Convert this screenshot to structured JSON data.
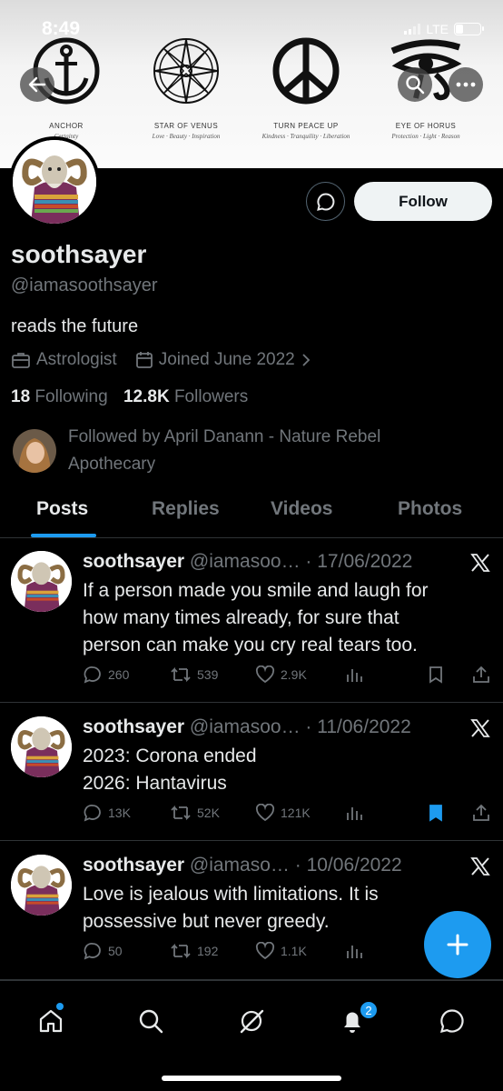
{
  "status_bar": {
    "time": "8:49",
    "network": "LTE",
    "battery_level": 0.3
  },
  "banner": {
    "symbols": [
      {
        "name": "ANCHOR",
        "subtitle": "Certainty",
        "icon": "anchor-icon"
      },
      {
        "name": "STAR OF VENUS",
        "subtitle": "Love · Beauty · Inspiration",
        "icon": "star-of-venus-icon"
      },
      {
        "name": "TURN PEACE UP",
        "subtitle": "Kindness · Tranquility · Liberation",
        "icon": "peace-icon"
      },
      {
        "name": "EYE OF HORUS",
        "subtitle": "Protection · Light · Reason",
        "icon": "eye-of-horus-icon"
      }
    ]
  },
  "profile": {
    "display_name": "soothsayer",
    "handle": "@iamasoothsayer",
    "bio": "reads the future",
    "category": "Astrologist",
    "joined": "Joined June 2022",
    "following_count": "18",
    "following_label": "Following",
    "followers_count": "12.8K",
    "followers_label": "Followers",
    "followed_by": "Followed by April Danann - Nature Rebel Apothecary",
    "follow_button": "Follow"
  },
  "tabs": [
    "Posts",
    "Replies",
    "Videos",
    "Photos"
  ],
  "active_tab": "Posts",
  "posts": [
    {
      "name": "soothsayer",
      "handle_date": "@iamasoo… · 17/06/2022",
      "lines": [
        "If a person made you smile and laugh for",
        "how many times already, for sure that",
        "person can make you cry real tears too."
      ],
      "replies": "260",
      "reposts": "539",
      "likes": "2.9K",
      "bookmarked": false
    },
    {
      "name": "soothsayer",
      "handle_date": "@iamasoo… · 11/06/2022",
      "lines": [
        "2023: Corona ended",
        "2026: Hantavirus"
      ],
      "replies": "13K",
      "reposts": "52K",
      "likes": "121K",
      "bookmarked": true
    },
    {
      "name": "soothsayer",
      "handle_date": "@iamaso… · 10/06/2022",
      "lines": [
        "Love is jealous with limitations. It is",
        "possessive but never greedy."
      ],
      "replies": "50",
      "reposts": "192",
      "likes": "1.1K",
      "bookmarked": false
    }
  ],
  "notifications_badge": "2",
  "colors": {
    "accent": "#1d9bf0",
    "muted": "#71767b",
    "text": "#e7e9ea",
    "divider": "#2f3336"
  }
}
